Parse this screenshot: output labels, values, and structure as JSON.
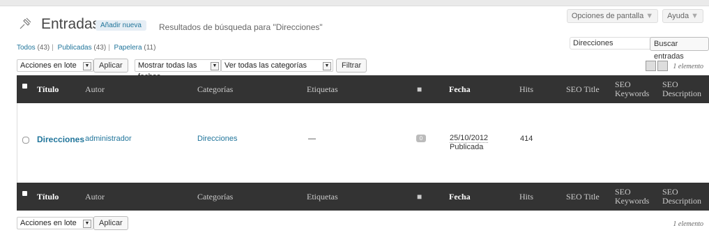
{
  "header": {
    "screen_options": "Opciones de pantalla",
    "help": "Ayuda",
    "title": "Entradas",
    "add_new": "Añadir nueva",
    "subtitle": "Resultados de búsqueda para \"Direcciones\""
  },
  "status_links": [
    {
      "label": "Todos",
      "count": "(43)"
    },
    {
      "label": "Publicadas",
      "count": "(43)"
    },
    {
      "label": "Papelera",
      "count": "(11)"
    }
  ],
  "search": {
    "value": "Direcciones",
    "button": "Buscar entradas"
  },
  "toolbar": {
    "bulk_actions": "Acciones en lote",
    "apply": "Aplicar",
    "dates": "Mostrar todas las fechas",
    "categories": "Ver todas las categorías",
    "filter": "Filtrar",
    "count": "1 elemento"
  },
  "columns": {
    "title": "Título",
    "author": "Autor",
    "categories": "Categorías",
    "tags": "Etiquetas",
    "date": "Fecha",
    "hits": "Hits",
    "seo_title": "SEO Title",
    "seo_keywords_1": "SEO",
    "seo_keywords_2": "Keywords",
    "seo_desc_1": "SEO",
    "seo_desc_2": "Description"
  },
  "rows": [
    {
      "title": "Direcciones",
      "author": "administrador",
      "categories": "Direcciones",
      "tags": "—",
      "comments": "0",
      "date": "25/10/2012",
      "status": "Publicada",
      "hits": "414"
    }
  ],
  "bottom_toolbar": {
    "bulk_actions": "Acciones en lote",
    "apply": "Aplicar",
    "count": "1 elemento"
  }
}
